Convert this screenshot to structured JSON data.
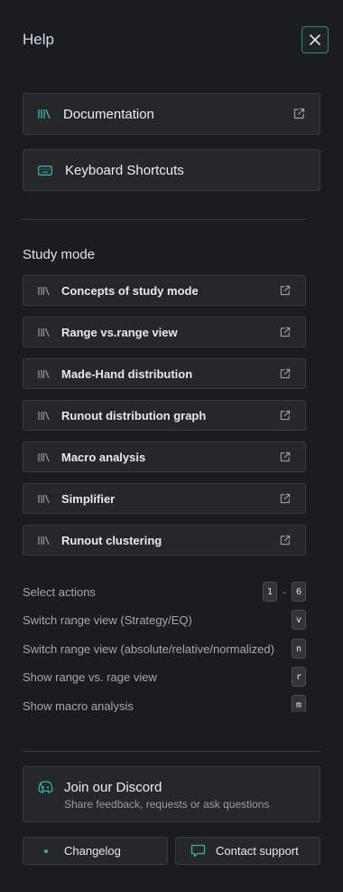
{
  "header": {
    "title": "Help"
  },
  "links": [
    {
      "label": "Documentation",
      "icon": "library-icon"
    },
    {
      "label": "Keyboard Shortcuts",
      "icon": "keyboard-icon"
    }
  ],
  "study": {
    "title": "Study mode",
    "items": [
      {
        "label": "Concepts of study mode"
      },
      {
        "label": "Range vs.range view"
      },
      {
        "label": "Made-Hand distribution"
      },
      {
        "label": "Runout distribution graph"
      },
      {
        "label": "Macro analysis"
      },
      {
        "label": "Simplifier"
      },
      {
        "label": "Runout clustering"
      }
    ]
  },
  "shortcuts": [
    {
      "label": "Select actions",
      "keys": [
        "1",
        "6"
      ]
    },
    {
      "label": "Switch range view (Strategy/EQ)",
      "keys": [
        "v"
      ]
    },
    {
      "label": "Switch range view (absolute/relative/normalized)",
      "keys": [
        "n"
      ]
    },
    {
      "label": "Show range vs. rage view",
      "keys": [
        "r"
      ]
    },
    {
      "label": "Show macro analysis",
      "keys": [
        "m"
      ]
    }
  ],
  "footer": {
    "discord_title": "Join our Discord",
    "discord_sub": "Share feedback, requests or ask questions",
    "changelog": "Changelog",
    "support": "Contact support"
  },
  "colors": {
    "accent": "#2fb5a9",
    "background": "#1b1c1d",
    "panel": "#262729",
    "border": "#3a3b3e"
  }
}
